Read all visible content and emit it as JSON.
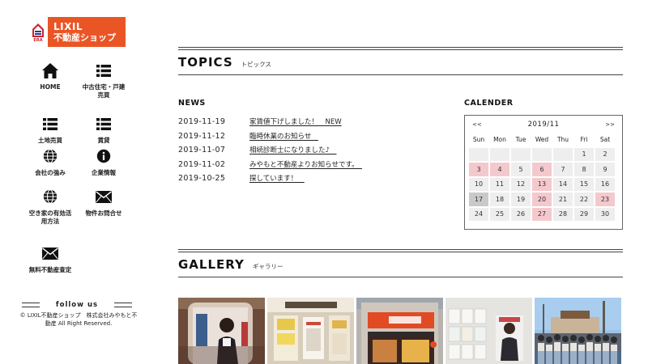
{
  "logo": {
    "era": "ERA",
    "line1": "LIXIL",
    "line2": "不動産ショップ"
  },
  "nav": [
    {
      "label": "HOME",
      "icon": "home-icon"
    },
    {
      "label": "中古住宅・戸建\n売買",
      "icon": "list-icon"
    },
    {
      "label": "土地売買",
      "icon": "list-icon"
    },
    {
      "label": "賃貸",
      "icon": "list-icon"
    },
    {
      "label": "会社の強み",
      "icon": "globe-icon"
    },
    {
      "label": "企業情報",
      "icon": "info-icon"
    },
    {
      "label": "空き家の有効活\n用方法",
      "icon": "globe-icon"
    },
    {
      "label": "物件お問合せ",
      "icon": "envelope-icon"
    },
    {
      "label": "無料不動産査定",
      "icon": "envelope-icon"
    }
  ],
  "follow": {
    "label": "follow us"
  },
  "copyright": "© LIXIL不動産ショップ　株式会社みやもと不動産 All Right Reserved.",
  "topics": {
    "title": "TOPICS",
    "subtitle": "トピックス"
  },
  "news": {
    "heading": "NEWS",
    "items": [
      {
        "date": "2019-11-19",
        "title": "家賃値下げしました！　NEW"
      },
      {
        "date": "2019-11-12",
        "title": "臨時休業のお知らせ　"
      },
      {
        "date": "2019-11-07",
        "title": "相続診断士になりました♪　"
      },
      {
        "date": "2019-11-02",
        "title": "みやもと不動産よりお知らせです。　"
      },
      {
        "date": "2019-10-25",
        "title": "探しています！　"
      }
    ]
  },
  "calendar": {
    "heading": "CALENDER",
    "prev": "<<",
    "next": ">>",
    "month": "2019/11",
    "weekdays": [
      "Sun",
      "Mon",
      "Tue",
      "Wed",
      "Thu",
      "Fri",
      "Sat"
    ],
    "rows": [
      [
        "",
        "",
        "",
        "",
        "",
        "1",
        "2"
      ],
      [
        "3",
        "4",
        "5",
        "6",
        "7",
        "8",
        "9"
      ],
      [
        "10",
        "11",
        "12",
        "13",
        "14",
        "15",
        "16"
      ],
      [
        "17",
        "18",
        "19",
        "20",
        "21",
        "22",
        "23"
      ],
      [
        "24",
        "25",
        "26",
        "27",
        "28",
        "29",
        "30"
      ]
    ],
    "highlight_pink": [
      "3",
      "4",
      "6",
      "13",
      "20",
      "23",
      "27"
    ],
    "highlight_gray": [
      "17"
    ],
    "colors": {
      "cell": "#eeeeee",
      "holiday": "#f4c9cd",
      "today": "#c9c9c9"
    }
  },
  "gallery": {
    "title": "GALLERY",
    "subtitle": "ギャラリー",
    "images": [
      "office-interior-poster-photo",
      "shop-window-flyers-photo",
      "lixil-storefront-photo",
      "wall-flyers-poster-photo",
      "festival-crowd-photo"
    ]
  },
  "colors": {
    "brand": "#ea5525",
    "era_red": "#d0202a",
    "text": "#222222"
  }
}
